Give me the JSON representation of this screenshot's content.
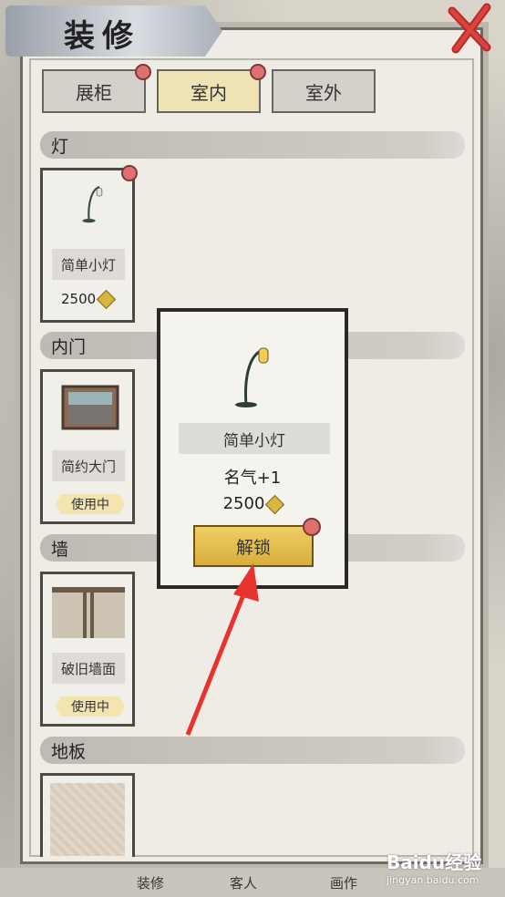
{
  "title": "装修",
  "tabs": [
    {
      "label": "展柜",
      "has_dot": true
    },
    {
      "label": "室内",
      "has_dot": true,
      "active": true
    },
    {
      "label": "室外",
      "has_dot": false
    }
  ],
  "sections": {
    "lamp": "灯",
    "door": "内门",
    "wall": "墙",
    "floor": "地板"
  },
  "cards": {
    "lamp": {
      "label": "简单小灯",
      "price": "2500"
    },
    "door": {
      "label": "简约大门",
      "status": "使用中"
    },
    "wall": {
      "label": "破旧墙面",
      "status": "使用中"
    }
  },
  "popup": {
    "name": "简单小灯",
    "effect": "名气+1",
    "cost": "2500",
    "button": "解锁"
  },
  "bottom_nav": [
    "装修",
    "客人",
    "画作"
  ],
  "watermark": {
    "brand": "Baidu经验",
    "url": "jingyan.baidu.com"
  },
  "colors": {
    "accent_gold": "#d8ad3b",
    "notify_red": "#e07070",
    "arrow_red": "#e8322e"
  }
}
